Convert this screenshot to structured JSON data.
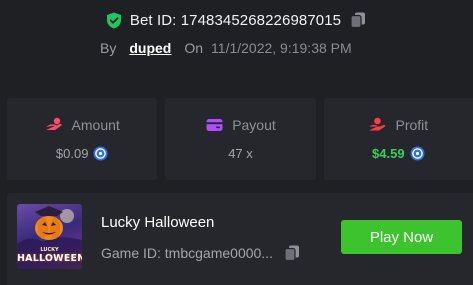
{
  "bet": {
    "id_text": "Bet ID: 1748345268226987015",
    "by_label": "By",
    "user": "duped",
    "on_label": "On",
    "date": "11/1/2022, 9:19:38 PM"
  },
  "stats": [
    {
      "label": "Amount",
      "value": "$0.09",
      "icon": "hand-coin-icon",
      "has_coin": true
    },
    {
      "label": "Payout",
      "value": "47 x",
      "icon": "wallet-icon",
      "has_coin": false
    },
    {
      "label": "Profit",
      "value": "$4.59",
      "icon": "hand-money-icon",
      "has_coin": true
    }
  ],
  "game": {
    "name": "Lucky Halloween",
    "id_text": "Game ID: tmbcgame0000...",
    "thumb_small": "LUCKY",
    "thumb_title": "HALLOWEEN",
    "play_label": "Play Now"
  },
  "colors": {
    "background": "#1f2024",
    "card": "#26272c",
    "accent_green": "#3cc32e",
    "profit_green": "#36d05a",
    "icon_pink": "#ff4d6d",
    "icon_purple": "#b04dff",
    "icon_red": "#ff3b4a",
    "shield_green": "#22c55e"
  }
}
